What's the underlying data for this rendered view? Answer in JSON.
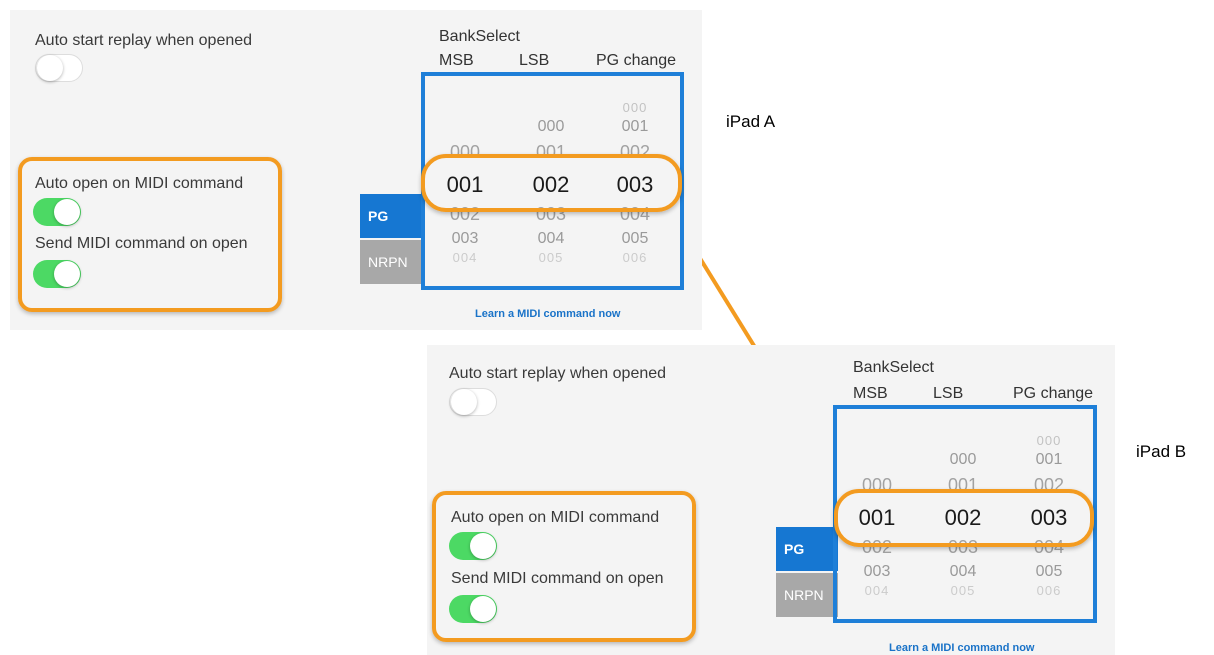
{
  "settings": {
    "auto_start_label": "Auto start replay when opened",
    "auto_start_on": false,
    "auto_open_label": "Auto open on MIDI command",
    "auto_open_on": true,
    "send_midi_label": "Send MIDI command on open",
    "send_midi_on": true
  },
  "picker": {
    "bank_select_label": "BankSelect",
    "msb_label": "MSB",
    "lsb_label": "LSB",
    "pg_change_label": "PG change",
    "msb_rows": [
      "000",
      "001",
      "002",
      "003",
      "004"
    ],
    "lsb_rows": [
      "000",
      "001",
      "002",
      "003",
      "004",
      "005"
    ],
    "pg_rows": [
      "000",
      "001",
      "002",
      "003",
      "004",
      "005",
      "006"
    ],
    "selected": {
      "msb": "001",
      "lsb": "002",
      "pg": "003"
    }
  },
  "modes": {
    "pg": "PG",
    "nrpn": "NRPN",
    "active": "PG"
  },
  "learn_link": "Learn a MIDI command now",
  "devices": {
    "a": "iPad A",
    "b": "iPad B"
  },
  "colors": {
    "highlight": "#f39b20",
    "frame": "#1e7fd8",
    "toggle_on": "#4cd964"
  }
}
